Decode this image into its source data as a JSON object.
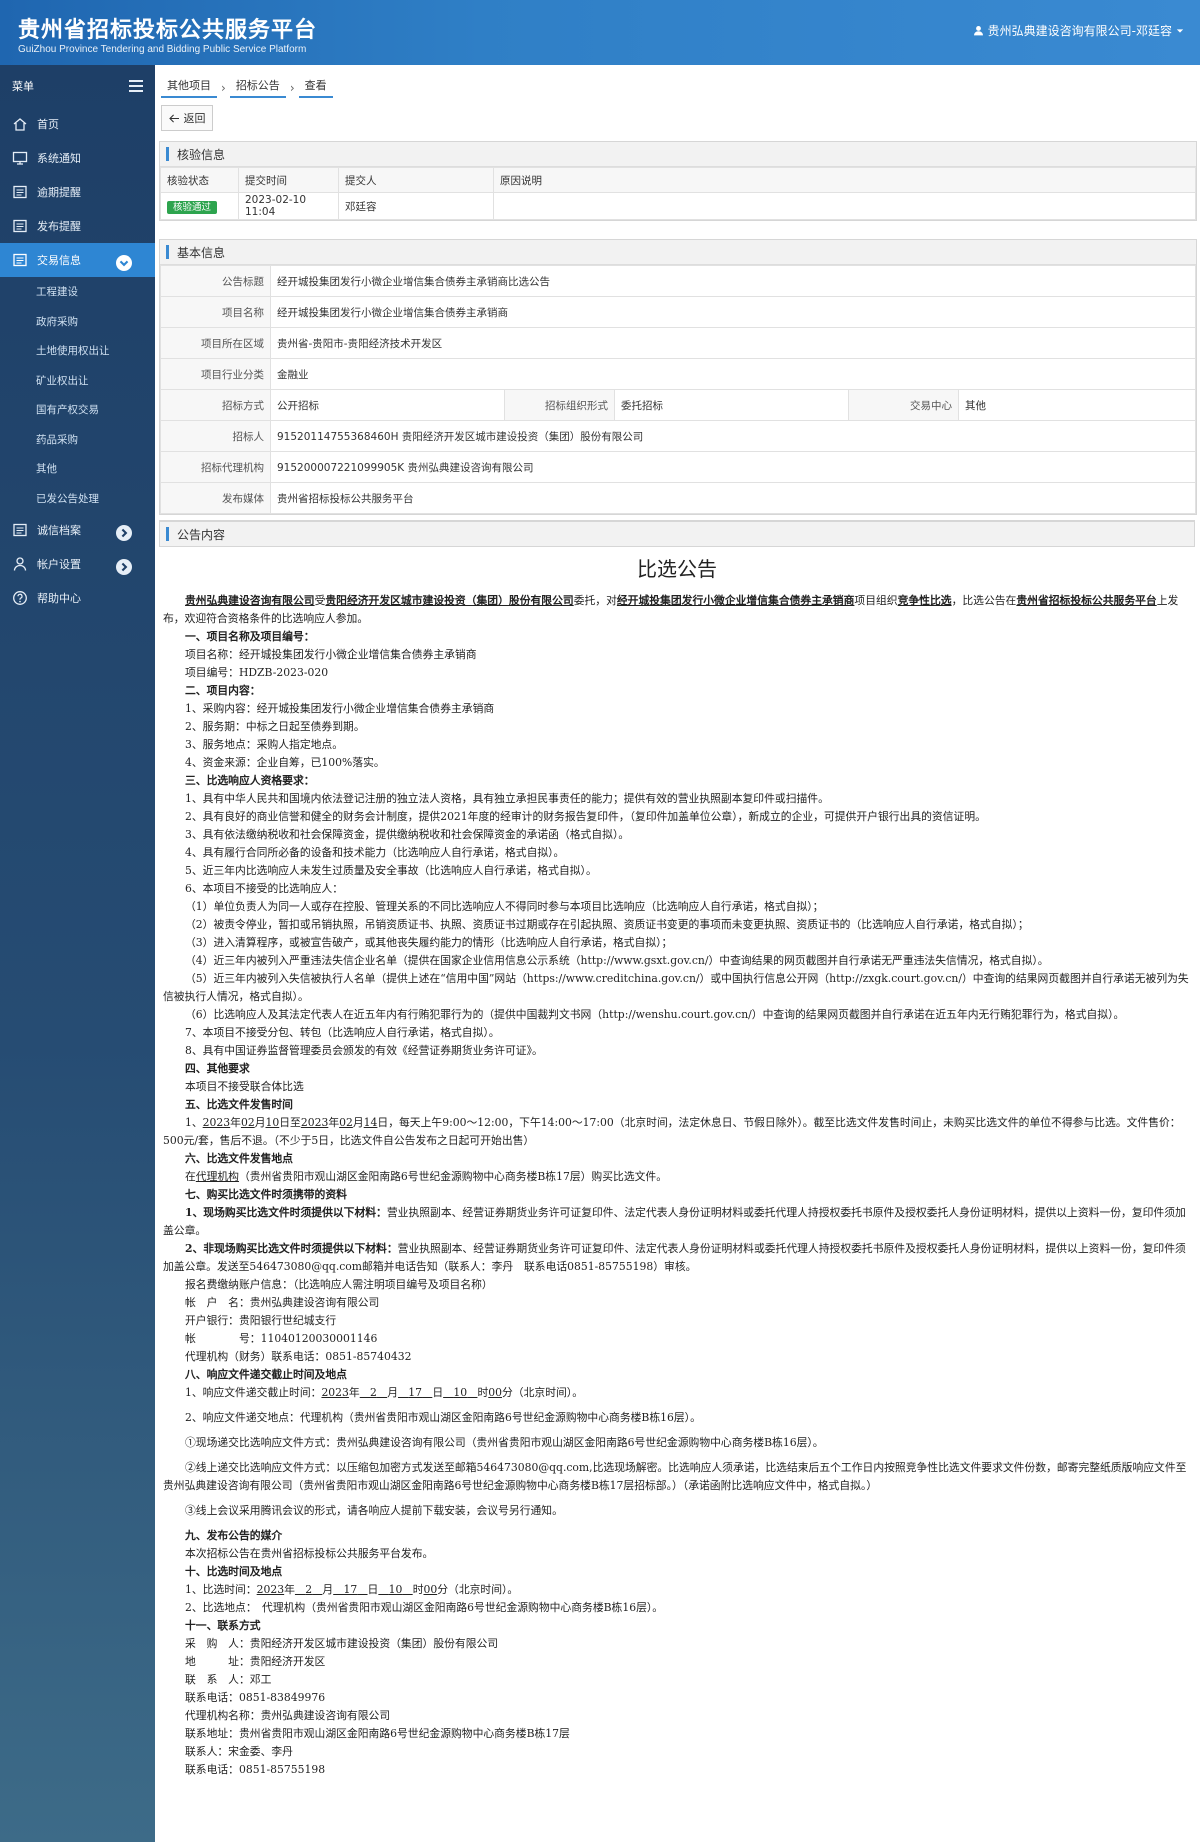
{
  "header": {
    "title": "贵州省招标投标公共服务平台",
    "subtitle": "GuiZhou Province Tendering and Bidding Public Service Platform",
    "user": "贵州弘典建设咨询有限公司-邓廷容"
  },
  "sidebar": {
    "menu_label": "菜单",
    "items": [
      {
        "label": "首页"
      },
      {
        "label": "系统通知"
      },
      {
        "label": "逾期提醒"
      },
      {
        "label": "发布提醒"
      },
      {
        "label": "交易信息"
      }
    ],
    "subitems": [
      "工程建设",
      "政府采购",
      "土地使用权出让",
      "矿业权出让",
      "国有产权交易",
      "药品采购",
      "其他",
      "已发公告处理"
    ],
    "items_after": [
      {
        "label": "诚信档案"
      },
      {
        "label": "帐户设置"
      },
      {
        "label": "帮助中心"
      }
    ]
  },
  "breadcrumb": [
    "其他项目",
    "招标公告",
    "查看"
  ],
  "back_label": "返回",
  "verify": {
    "title": "核验信息",
    "headers": [
      "核验状态",
      "提交时间",
      "提交人",
      "原因说明"
    ],
    "status": "核验通过",
    "time": "2023-02-10 11:04",
    "submitter": "邓廷容",
    "reason": ""
  },
  "basic": {
    "title": "基本信息",
    "rows": [
      {
        "label": "公告标题",
        "value": "经开城投集团发行小微企业增信集合债券主承销商比选公告"
      },
      {
        "label": "项目名称",
        "value": "经开城投集团发行小微企业增信集合债券主承销商"
      },
      {
        "label": "项目所在区域",
        "value": "贵州省-贵阳市-贵阳经济技术开发区"
      },
      {
        "label": "项目行业分类",
        "value": "金融业"
      }
    ],
    "method_label": "招标方式",
    "method": "公开招标",
    "org_label": "招标组织形式",
    "org": "委托招标",
    "center_label": "交易中心",
    "center": "其他",
    "rows2": [
      {
        "label": "招标人",
        "value": "91520114755368460H 贵阳经济开发区城市建设投资（集团）股份有限公司"
      },
      {
        "label": "招标代理机构",
        "value": "915200007221099905K 贵州弘典建设咨询有限公司"
      },
      {
        "label": "发布媒体",
        "value": "贵州省招标投标公共服务平台"
      }
    ]
  },
  "notice": {
    "title": "公告内容",
    "doc_title": "比选公告",
    "intro": {
      "agent": "贵州弘典建设咨询有限公司",
      "t1": "受",
      "owner": "贵阳经济开发区城市建设投资（集团）股份有限公司",
      "t2": "委托，对",
      "project": "经开城投集团发行小微企业增信集合债券主承销商",
      "t3": "项目组织",
      "mode": "竞争性比选",
      "t4": "，比选公告在",
      "platform": "贵州省招标投标公共服务平台",
      "t5": "上发布，欢迎符合资格条件的比选响应人参加。"
    },
    "lines_a": [
      {
        "t": "一、项目名称及项目编号：",
        "c": "sec"
      },
      {
        "t": "项目名称：经开城投集团发行小微企业增信集合债券主承销商",
        "c": "i"
      },
      {
        "t": "项目编号：HDZB-2023-020",
        "c": "i"
      },
      {
        "t": "二、项目内容：",
        "c": "sec"
      },
      {
        "t": "1、采购内容：经开城投集团发行小微企业增信集合债券主承销商",
        "c": "i"
      },
      {
        "t": "2、服务期：中标之日起至债券到期。",
        "c": "i"
      },
      {
        "t": "3、服务地点：采购人指定地点。",
        "c": "i"
      },
      {
        "t": "4、资金来源：企业自筹，已100%落实。",
        "c": "i"
      },
      {
        "t": "三、比选响应人资格要求：",
        "c": "sec"
      },
      {
        "t": "1、具有中华人民共和国境内依法登记注册的独立法人资格，具有独立承担民事责任的能力；提供有效的营业执照副本复印件或扫描件。",
        "c": "i"
      },
      {
        "t": "2、具有良好的商业信誉和健全的财务会计制度，提供2021年度的经审计的财务报告复印件，（复印件加盖单位公章），新成立的企业，可提供开户银行出具的资信证明。",
        "c": "i"
      },
      {
        "t": "3、具有依法缴纳税收和社会保障资金，提供缴纳税收和社会保障资金的承诺函（格式自拟）。",
        "c": "i"
      },
      {
        "t": "4、具有履行合同所必备的设备和技术能力（比选响应人自行承诺，格式自拟）。",
        "c": "i"
      },
      {
        "t": "5、近三年内比选响应人未发生过质量及安全事故（比选响应人自行承诺，格式自拟）。",
        "c": "i"
      },
      {
        "t": "6、本项目不接受的比选响应人：",
        "c": "i"
      },
      {
        "t": "（1）单位负责人为同一人或存在控股、管理关系的不同比选响应人不得同时参与本项目比选响应（比选响应人自行承诺，格式自拟）；",
        "c": "i"
      },
      {
        "t": "（2）被责令停业，暂扣或吊销执照，吊销资质证书、执照、资质证书过期或存在引起执照、资质证书变更的事项而未变更执照、资质证书的（比选响应人自行承诺，格式自拟）；",
        "c": "i"
      },
      {
        "t": "（3）进入清算程序，或被宣告破产，或其他丧失履约能力的情形（比选响应人自行承诺，格式自拟）；",
        "c": "i"
      },
      {
        "t": "（4）近三年内被列入严重违法失信企业名单（提供在国家企业信用信息公示系统（http://www.gsxt.gov.cn/）中查询结果的网页截图并自行承诺无严重违法失信情况，格式自拟）。",
        "c": "i"
      },
      {
        "t": "（5）近三年内被列入失信被执行人名单（提供上述在“信用中国”网站（https://www.creditchina.gov.cn/）或中国执行信息公开网（http://zxgk.court.gov.cn/）中查询的结果网页截图并自行承诺无被列为失信被执行人情况，格式自拟）。",
        "c": "i"
      },
      {
        "t": "（6）比选响应人及其法定代表人在近五年内有行贿犯罪行为的（提供中国裁判文书网（http://wenshu.court.gov.cn/）中查询的结果网页截图并自行承诺在近五年内无行贿犯罪行为，格式自拟）。",
        "c": "i"
      },
      {
        "t": "7、本项目不接受分包、转包（比选响应人自行承诺，格式自拟）。",
        "c": "i"
      },
      {
        "t": "8、具有中国证券监督管理委员会颁发的有效《经营证券期货业务许可证》。",
        "c": "i"
      },
      {
        "t": "四、其他要求",
        "c": "sec"
      },
      {
        "t": "本项目不接受联合体比选",
        "c": "i"
      },
      {
        "t": "五、比选文件发售时间",
        "c": "sec"
      }
    ],
    "sale_time": {
      "p1": "1、",
      "y1": "2023",
      "p2": "年",
      "m1": "02",
      "p3": "月",
      "d1": "10",
      "p4": "日至",
      "y2": "2023",
      "p5": "年",
      "m2": "02",
      "p6": "月",
      "d2": "14",
      "p7": "日，每天上午9:00～12:00，下午14:00～17:00（北京时间，法定休息日、节假日除外）。截至比选文件发售时间止，未购买比选文件的单位不得参与比选。文件售价：500元/套，售后不退。（不少于5日，比选文件自公告发布之日起可开始出售）"
    },
    "sec6": "六、比选文件发售地点",
    "place": {
      "a": "在",
      "b": "代理机构",
      "c": "（贵州省贵阳市观山湖区金阳南路6号世纪金源购物中心商务楼B栋17层）购买比选文件。"
    },
    "sec7": "七、购买比选文件时须携带的资料",
    "onsite": {
      "h": "1、现场购买比选文件时须提供以下材料：",
      "t": "营业执照副本、经营证券期货业务许可证复印件、法定代表人身份证明材料或委托代理人持授权委托书原件及授权委托人身份证明材料，提供以上资料一份，复印件须加盖公章。"
    },
    "offsite": {
      "h": "2、非现场购买比选文件时须提供以下材料：",
      "t": "营业执照副本、经营证券期货业务许可证复印件、法定代表人身份证明材料或委托代理人持授权委托书原件及授权委托人身份证明材料，提供以上资料一份，复印件须加盖公章。发送至546473080@qq.com邮箱并电话告知（联系人：李丹　联系电话0851-85755198）审核。"
    },
    "lines_b": [
      {
        "t": "报名费缴纳账户信息：（比选响应人需注明项目编号及项目名称）",
        "c": "i"
      },
      {
        "t": "帐　户　名：贵州弘典建设咨询有限公司",
        "c": "i"
      },
      {
        "t": "开户银行：贵阳银行世纪城支行",
        "c": "i"
      },
      {
        "t": "帐　　　　号：11040120030001146",
        "c": "i"
      },
      {
        "t": "代理机构（财务）联系电话：0851-85740432",
        "c": "i"
      },
      {
        "t": "八、响应文件递交截止时间及地点",
        "c": "sec"
      }
    ],
    "deadline": {
      "p1": "1、响应文件递交截止时间：",
      "y": "2023",
      "p2": "年",
      "m": "2",
      "p3": "月",
      "d": "17",
      "p4": "日",
      "h": "10",
      "p5": "时",
      "mi": "00",
      "p6": "分（北京时间）。"
    },
    "lines_c": [
      {
        "t": "2、响应文件递交地点：代理机构（贵州省贵阳市观山湖区金阳南路6号世纪金源购物中心商务楼B栋16层）。",
        "c": "i gap"
      },
      {
        "t": "①现场递交比选响应文件方式：贵州弘典建设咨询有限公司（贵州省贵阳市观山湖区金阳南路6号世纪金源购物中心商务楼B栋16层）。",
        "c": "i gap"
      },
      {
        "t": "②线上递交比选响应文件方式：以压缩包加密方式发送至邮箱546473080@qq.com,比选现场解密。比选响应人须承诺，比选结束后五个工作日内按照竞争性比选文件要求文件份数，邮寄完整纸质版响应文件至贵州弘典建设咨询有限公司（贵州省贵阳市观山湖区金阳南路6号世纪金源购物中心商务楼B栋17层招标部。）（承诺函附比选响应文件中，格式自拟。）",
        "c": "i gap"
      },
      {
        "t": "③线上会议采用腾讯会议的形式，请各响应人提前下载安装，会议号另行通知。",
        "c": "i gap"
      },
      {
        "t": "九、发布公告的媒介",
        "c": "sec gap"
      },
      {
        "t": "本次招标公告在贵州省招标投标公共服务平台发布。",
        "c": "i"
      },
      {
        "t": "十、比选时间及地点",
        "c": "sec"
      }
    ],
    "compare_time": {
      "p1": "1、比选时间：",
      "y": "2023",
      "p2": "年",
      "m": "2",
      "p3": "月",
      "d": "17",
      "p4": "日",
      "h": "10",
      "p5": "时",
      "mi": "00",
      "p6": "分（北京时间）。"
    },
    "lines_d": [
      {
        "t": "2、比选地点：　代理机构（贵州省贵阳市观山湖区金阳南路6号世纪金源购物中心商务楼B栋16层）。",
        "c": "i"
      },
      {
        "t": "十一、联系方式",
        "c": "sec"
      },
      {
        "t": "采　购　人：贵阳经济开发区城市建设投资（集团）股份有限公司",
        "c": "i"
      },
      {
        "t": "地　　　址：贵阳经济开发区",
        "c": "i"
      },
      {
        "t": "联　系　人：邓工",
        "c": "i"
      },
      {
        "t": "联系电话：0851-83849976",
        "c": "i"
      },
      {
        "t": "代理机构名称：贵州弘典建设咨询有限公司",
        "c": "i"
      },
      {
        "t": "联系地址：贵州省贵阳市观山湖区金阳南路6号世纪金源购物中心商务楼B栋17层",
        "c": "i"
      },
      {
        "t": "联系人：宋金委、李丹",
        "c": "i"
      },
      {
        "t": "联系电话：0851-85755198",
        "c": "i"
      }
    ]
  },
  "colors": {
    "header": "#2f7fc6",
    "sidebar": "#1e3f67",
    "active": "#2e86d3",
    "pass": "#2da44e"
  }
}
